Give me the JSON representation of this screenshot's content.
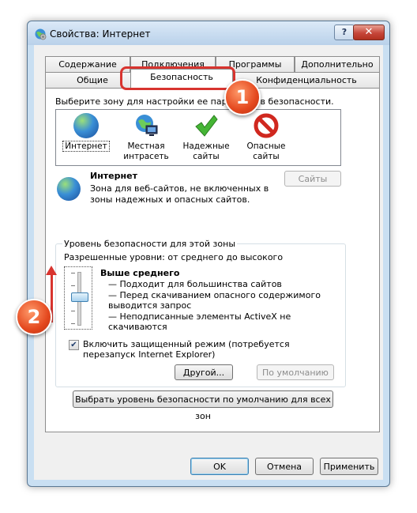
{
  "window": {
    "title": "Свойства: Интернет",
    "help": "?",
    "close": "✕"
  },
  "tabs": {
    "row1": [
      "Содержание",
      "Подключения",
      "Программы",
      "Дополнительно"
    ],
    "row2": [
      "Общие",
      "Безопасность",
      "Конфиденциальность"
    ],
    "active": "Безопасность"
  },
  "security": {
    "zone_prompt": "Выберите зону для настройки ее параметров безопасности.",
    "zones": [
      {
        "label": "Интернет",
        "icon": "globe-icon",
        "selected": true
      },
      {
        "label": "Местная интрасеть",
        "icon": "intranet-icon"
      },
      {
        "label": "Надежные сайты",
        "icon": "checkmark-icon"
      },
      {
        "label": "Опасные сайты",
        "icon": "blocked-icon"
      }
    ],
    "zone_title": "Интернет",
    "zone_description": "Зона для веб-сайтов, не включенных в зоны надежных и опасных сайтов.",
    "sites_button": "Сайты",
    "level_legend": "Уровень безопасности для этой зоны",
    "allowed_levels": "Разрешенные уровни: от среднего до высокого",
    "level_title": "Выше среднего",
    "level_bullets": [
      "— Подходит для большинства сайтов",
      "— Перед скачиванием опасного содержимого выводится запрос",
      "— Неподписанные элементы ActiveX не скачиваются"
    ],
    "slider_level": "3 of 5",
    "protected_mode_checked": true,
    "protected_mode_label": "Включить защищенный режим (потребуется перезапуск Internet Explorer)",
    "custom_button": "Другой...",
    "default_level_button": "По умолчанию",
    "all_zones_button": "Выбрать уровень безопасности по умолчанию для всех зон"
  },
  "footer": {
    "ok": "OK",
    "cancel": "Отмена",
    "apply": "Применить"
  },
  "annotations": {
    "marker1": "1",
    "marker2": "2"
  },
  "colors": {
    "annotation_red": "#d8342f",
    "titlebar": "#c9dff2",
    "accent": "#3c7fb1"
  }
}
